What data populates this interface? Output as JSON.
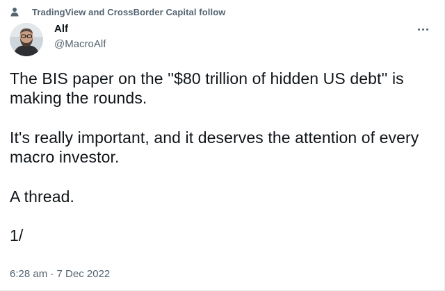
{
  "social_context": {
    "icon": "person-icon",
    "text": "TradingView and CrossBorder Capital follow"
  },
  "author": {
    "name": "Alf",
    "handle": "@MacroAlf",
    "avatar": "avatar-photo"
  },
  "menu": {
    "icon": "more-options-icon"
  },
  "tweet": {
    "paragraphs": [
      "The BIS paper on the ''$80 trillion of hidden US debt'' is making the rounds.",
      "It's really important, and it deserves the attention of every macro investor.",
      "A thread.",
      "1/"
    ]
  },
  "timestamp": {
    "time": "6:28 am",
    "separator": "·",
    "date": "7 Dec 2022"
  },
  "colors": {
    "text_primary": "#0f1419",
    "text_secondary": "#536471",
    "border": "#e6ecf0"
  }
}
